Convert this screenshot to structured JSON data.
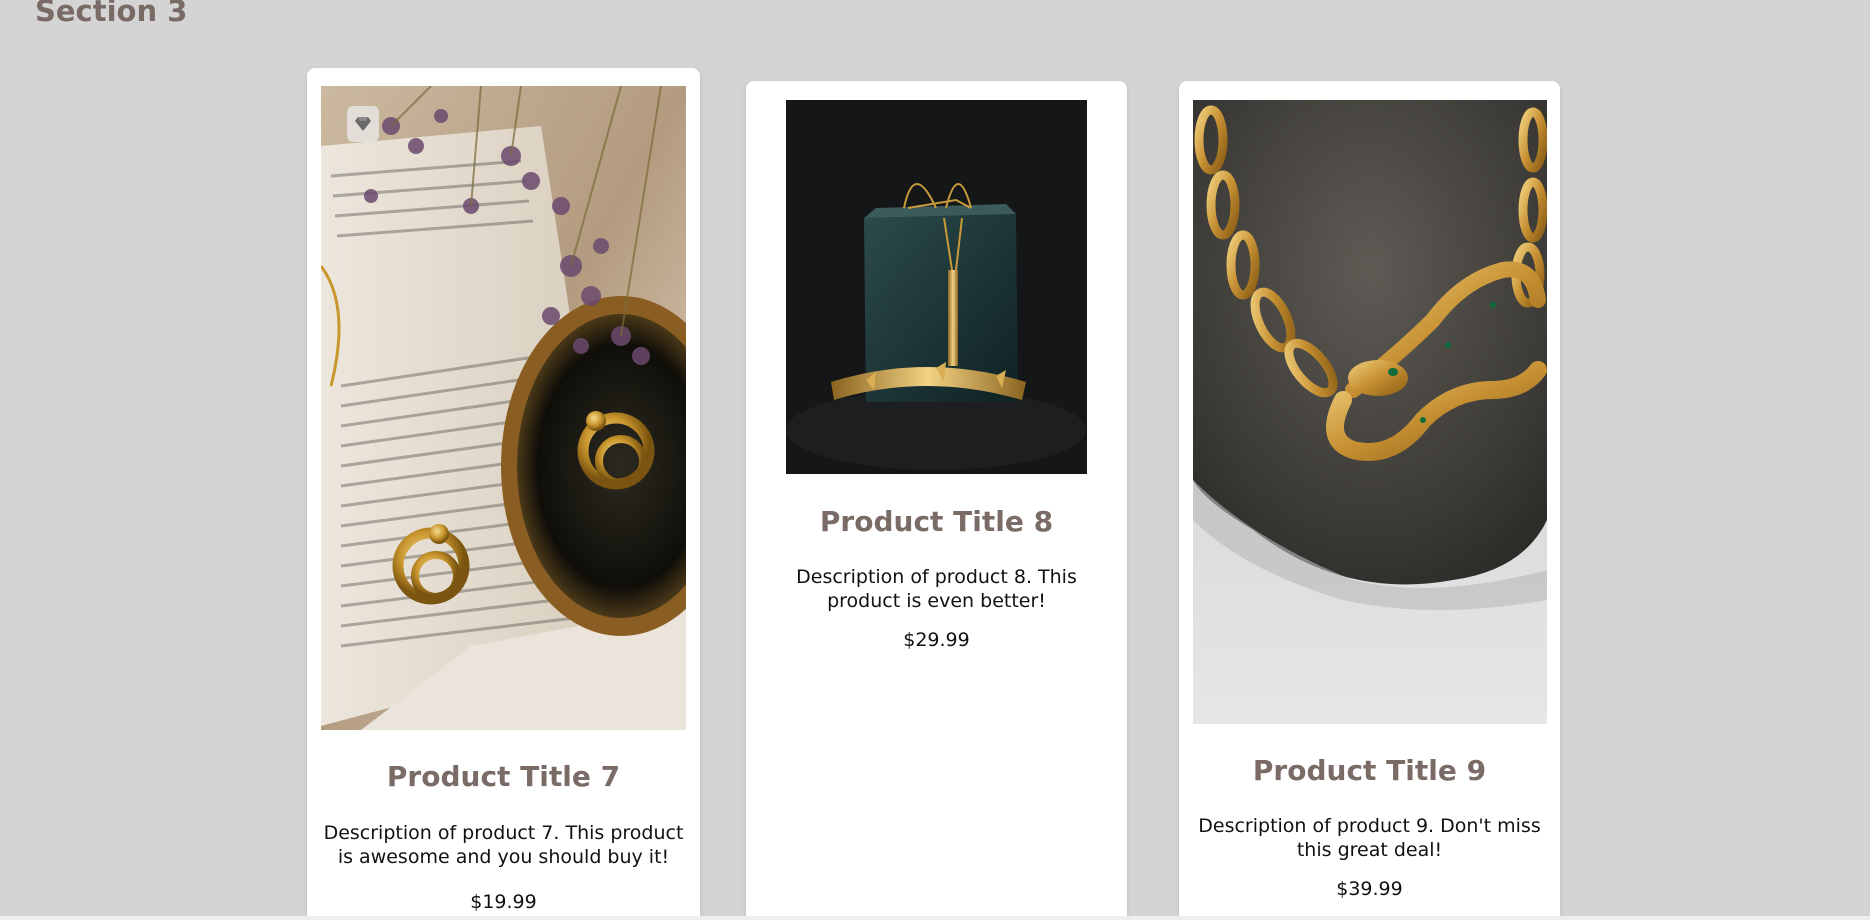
{
  "section": {
    "title": "Section 3"
  },
  "products": [
    {
      "title": "Product Title 7",
      "description": "Description of product 7. This product is awesome and you should buy it!",
      "price": "$19.99",
      "image_icon": "jewelry-photo-earrings-mirror-book"
    },
    {
      "title": "Product Title 8",
      "description": "Description of product 8. This product is even better!",
      "price": "$29.99",
      "image_icon": "jewelry-photo-necklace-box"
    },
    {
      "title": "Product Title 9",
      "description": "Description of product 9. Don't miss this great deal!",
      "price": "$39.99",
      "image_icon": "jewelry-photo-snake-chain-rock"
    }
  ],
  "badge": {
    "icon": "diamond-icon"
  },
  "colors": {
    "background": "#d4d4d4",
    "card": "#ffffff",
    "title": "#7b6b67",
    "text": "#111111"
  }
}
